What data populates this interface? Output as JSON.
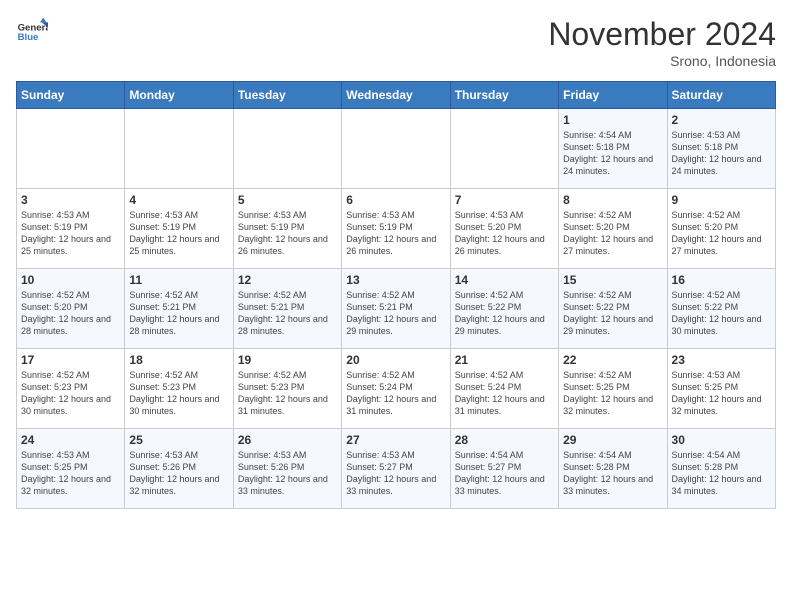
{
  "header": {
    "logo_line1": "General",
    "logo_line2": "Blue",
    "month": "November 2024",
    "location": "Srono, Indonesia"
  },
  "days_of_week": [
    "Sunday",
    "Monday",
    "Tuesday",
    "Wednesday",
    "Thursday",
    "Friday",
    "Saturday"
  ],
  "weeks": [
    [
      {
        "day": "",
        "info": ""
      },
      {
        "day": "",
        "info": ""
      },
      {
        "day": "",
        "info": ""
      },
      {
        "day": "",
        "info": ""
      },
      {
        "day": "",
        "info": ""
      },
      {
        "day": "1",
        "info": "Sunrise: 4:54 AM\nSunset: 5:18 PM\nDaylight: 12 hours and 24 minutes."
      },
      {
        "day": "2",
        "info": "Sunrise: 4:53 AM\nSunset: 5:18 PM\nDaylight: 12 hours and 24 minutes."
      }
    ],
    [
      {
        "day": "3",
        "info": "Sunrise: 4:53 AM\nSunset: 5:19 PM\nDaylight: 12 hours and 25 minutes."
      },
      {
        "day": "4",
        "info": "Sunrise: 4:53 AM\nSunset: 5:19 PM\nDaylight: 12 hours and 25 minutes."
      },
      {
        "day": "5",
        "info": "Sunrise: 4:53 AM\nSunset: 5:19 PM\nDaylight: 12 hours and 26 minutes."
      },
      {
        "day": "6",
        "info": "Sunrise: 4:53 AM\nSunset: 5:19 PM\nDaylight: 12 hours and 26 minutes."
      },
      {
        "day": "7",
        "info": "Sunrise: 4:53 AM\nSunset: 5:20 PM\nDaylight: 12 hours and 26 minutes."
      },
      {
        "day": "8",
        "info": "Sunrise: 4:52 AM\nSunset: 5:20 PM\nDaylight: 12 hours and 27 minutes."
      },
      {
        "day": "9",
        "info": "Sunrise: 4:52 AM\nSunset: 5:20 PM\nDaylight: 12 hours and 27 minutes."
      }
    ],
    [
      {
        "day": "10",
        "info": "Sunrise: 4:52 AM\nSunset: 5:20 PM\nDaylight: 12 hours and 28 minutes."
      },
      {
        "day": "11",
        "info": "Sunrise: 4:52 AM\nSunset: 5:21 PM\nDaylight: 12 hours and 28 minutes."
      },
      {
        "day": "12",
        "info": "Sunrise: 4:52 AM\nSunset: 5:21 PM\nDaylight: 12 hours and 28 minutes."
      },
      {
        "day": "13",
        "info": "Sunrise: 4:52 AM\nSunset: 5:21 PM\nDaylight: 12 hours and 29 minutes."
      },
      {
        "day": "14",
        "info": "Sunrise: 4:52 AM\nSunset: 5:22 PM\nDaylight: 12 hours and 29 minutes."
      },
      {
        "day": "15",
        "info": "Sunrise: 4:52 AM\nSunset: 5:22 PM\nDaylight: 12 hours and 29 minutes."
      },
      {
        "day": "16",
        "info": "Sunrise: 4:52 AM\nSunset: 5:22 PM\nDaylight: 12 hours and 30 minutes."
      }
    ],
    [
      {
        "day": "17",
        "info": "Sunrise: 4:52 AM\nSunset: 5:23 PM\nDaylight: 12 hours and 30 minutes."
      },
      {
        "day": "18",
        "info": "Sunrise: 4:52 AM\nSunset: 5:23 PM\nDaylight: 12 hours and 30 minutes."
      },
      {
        "day": "19",
        "info": "Sunrise: 4:52 AM\nSunset: 5:23 PM\nDaylight: 12 hours and 31 minutes."
      },
      {
        "day": "20",
        "info": "Sunrise: 4:52 AM\nSunset: 5:24 PM\nDaylight: 12 hours and 31 minutes."
      },
      {
        "day": "21",
        "info": "Sunrise: 4:52 AM\nSunset: 5:24 PM\nDaylight: 12 hours and 31 minutes."
      },
      {
        "day": "22",
        "info": "Sunrise: 4:52 AM\nSunset: 5:25 PM\nDaylight: 12 hours and 32 minutes."
      },
      {
        "day": "23",
        "info": "Sunrise: 4:53 AM\nSunset: 5:25 PM\nDaylight: 12 hours and 32 minutes."
      }
    ],
    [
      {
        "day": "24",
        "info": "Sunrise: 4:53 AM\nSunset: 5:25 PM\nDaylight: 12 hours and 32 minutes."
      },
      {
        "day": "25",
        "info": "Sunrise: 4:53 AM\nSunset: 5:26 PM\nDaylight: 12 hours and 32 minutes."
      },
      {
        "day": "26",
        "info": "Sunrise: 4:53 AM\nSunset: 5:26 PM\nDaylight: 12 hours and 33 minutes."
      },
      {
        "day": "27",
        "info": "Sunrise: 4:53 AM\nSunset: 5:27 PM\nDaylight: 12 hours and 33 minutes."
      },
      {
        "day": "28",
        "info": "Sunrise: 4:54 AM\nSunset: 5:27 PM\nDaylight: 12 hours and 33 minutes."
      },
      {
        "day": "29",
        "info": "Sunrise: 4:54 AM\nSunset: 5:28 PM\nDaylight: 12 hours and 33 minutes."
      },
      {
        "day": "30",
        "info": "Sunrise: 4:54 AM\nSunset: 5:28 PM\nDaylight: 12 hours and 34 minutes."
      }
    ]
  ]
}
